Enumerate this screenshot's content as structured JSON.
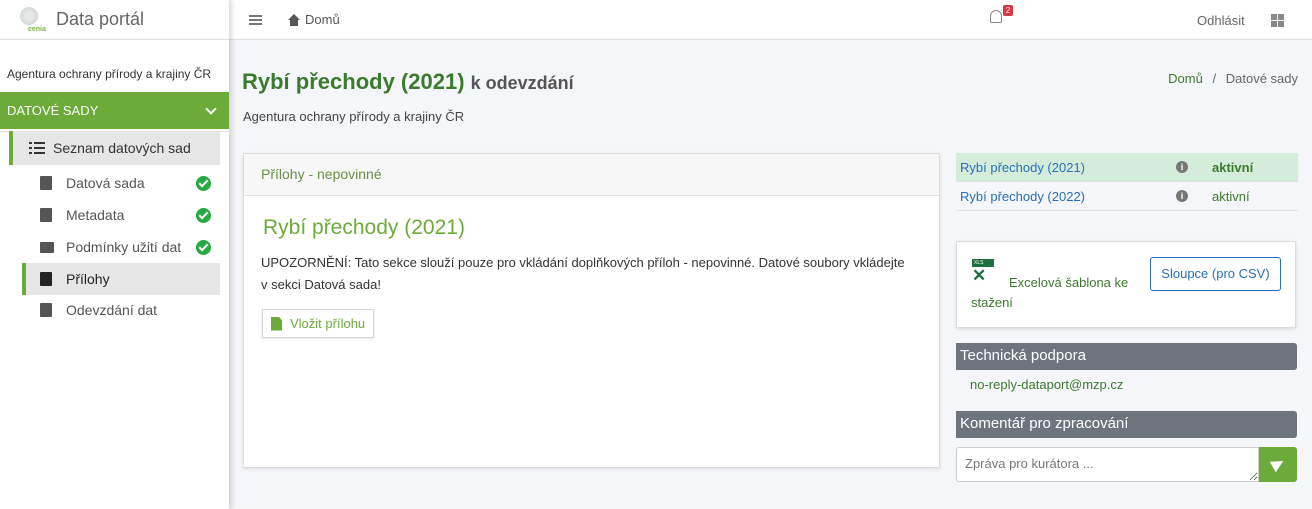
{
  "brand": {
    "name": "Data portál",
    "logo_text": "cenia"
  },
  "sidebar": {
    "org": "Agentura ochrany přírody a krajiny ČR",
    "section": "DATOVÉ SADY",
    "list_head": "Seznam datových sad",
    "items": [
      {
        "label": "Datová sada",
        "icon": "clipboard-icon",
        "done": true
      },
      {
        "label": "Metadata",
        "icon": "clipboard-list-icon",
        "done": true
      },
      {
        "label": "Podmínky užití dat",
        "icon": "briefcase-icon",
        "done": true
      },
      {
        "label": "Přílohy",
        "icon": "file-icon",
        "active": true
      },
      {
        "label": "Odevzdání dat",
        "icon": "clipboard-check-icon"
      }
    ]
  },
  "topbar": {
    "home": "Domů",
    "notification_count": "2",
    "logout": "Odhlásit"
  },
  "page": {
    "title": "Rybí přechody (2021)",
    "title_suffix": "k odevzdání",
    "subtitle": "Agentura ochrany přírody a krajiny ČR",
    "breadcrumb": {
      "home": "Domů",
      "separator": "/",
      "current": "Datové sady"
    }
  },
  "card": {
    "header": "Přílohy - nepovinné",
    "title": "Rybí přechody (2021)",
    "text": "UPOZORNĚNÍ: Tato sekce slouží pouze pro vkládání doplňkových příloh - nepovinné. Datové soubory vkládejte v sekci Datová sada!",
    "button": "Vložit přílohu"
  },
  "versions": [
    {
      "name": "Rybí přechody (2021)",
      "status": "aktivní",
      "highlight": true
    },
    {
      "name": "Rybí přechody (2022)",
      "status": "aktivní",
      "highlight": false
    }
  ],
  "excel": {
    "icon_text": "XLS",
    "label": "Excelová šablona ke stažení",
    "columns_button": "Sloupce (pro CSV)"
  },
  "support": {
    "header": "Technická podpora",
    "email": "no-reply-dataport@mzp.cz"
  },
  "comment": {
    "header": "Komentář pro zpracování",
    "placeholder": "Zpráva pro kurátora ..."
  },
  "colors": {
    "accent": "#6cab3a",
    "link": "#2a6ebb",
    "title": "#3c7a2e",
    "badge": "#dc3545"
  }
}
